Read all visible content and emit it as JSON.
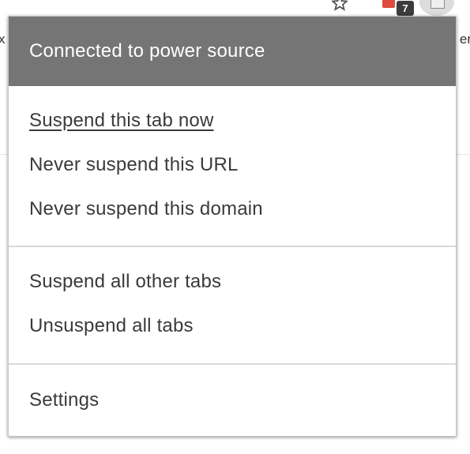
{
  "browser": {
    "left_edge_text": "x",
    "right_edge_text": "er",
    "extension_badge_count": "7",
    "icons": [
      "star-icon",
      "extension-red-icon",
      "suspender-extension-icon"
    ]
  },
  "popup": {
    "status": "Connected to power source",
    "groups": [
      {
        "items": [
          {
            "label": "Suspend this tab now",
            "underlined": true
          },
          {
            "label": "Never suspend this URL"
          },
          {
            "label": "Never suspend this domain"
          }
        ]
      },
      {
        "items": [
          {
            "label": "Suspend all other tabs"
          },
          {
            "label": "Unsuspend all tabs"
          }
        ]
      },
      {
        "items": [
          {
            "label": "Settings"
          }
        ]
      }
    ]
  },
  "colors": {
    "header_bg": "#757575",
    "header_text": "#ffffff",
    "item_text": "#3a3a3a",
    "separator": "#d9d9d9"
  }
}
